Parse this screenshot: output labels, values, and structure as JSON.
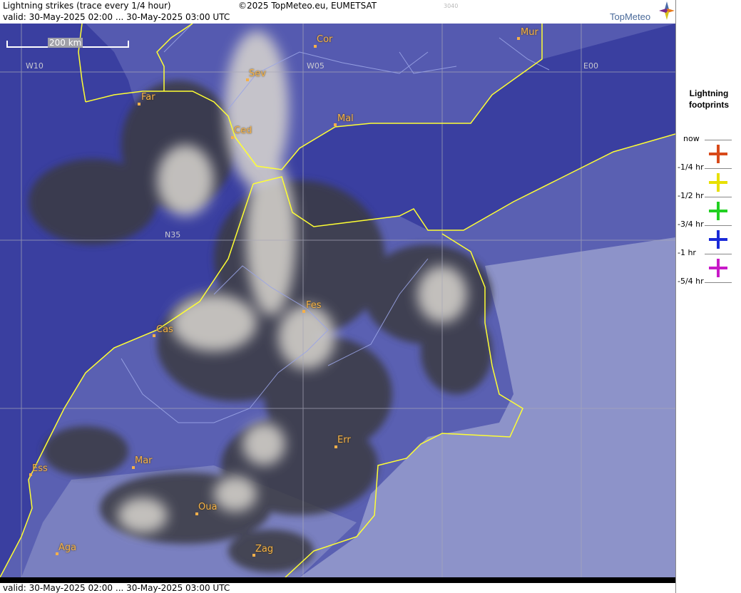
{
  "header": {
    "title": "Lightning strikes (trace every 1/4 hour)",
    "valid": "valid:  30-May-2025 02:00 ... 30-May-2025 03:00 UTC",
    "copyright": "©2025 TopMeteo.eu, EUMETSAT",
    "code": "3040",
    "logo_text": "TopMeteo"
  },
  "footer": {
    "valid": "valid:  30-May-2025 02:00 ... 30-May-2025 03:00 UTC"
  },
  "map": {
    "scale_label": "200 km",
    "grid_labels": {
      "w10": "W10",
      "w05": "W05",
      "e00": "E00",
      "n35": "N35"
    },
    "cities": {
      "cor": "Cor",
      "mur": "Mur",
      "sev": "Sev",
      "far": "Far",
      "ced": "Ced",
      "mal": "Mal",
      "fes": "Fes",
      "cas": "Cas",
      "err": "Err",
      "ess": "Ess",
      "mar": "Mar",
      "oua": "Oua",
      "aga": "Aga",
      "zag": "Zag"
    },
    "colors": {
      "sea": "#3a3fa0",
      "land": "#6a70b8",
      "desert": "#8d93c9",
      "cloud": "#d9d6cf",
      "border": "#ffff33",
      "river": "#9aa4e6",
      "city": "#f5b04a"
    }
  },
  "legend": {
    "title_line1": "Lightning",
    "title_line2": "footprints",
    "items": [
      {
        "label": "now",
        "color": "#d84a1a"
      },
      {
        "label": "-1/4 hr",
        "color": "#e8e000"
      },
      {
        "label": "-1/2 hr",
        "color": "#22d022"
      },
      {
        "label": "-3/4 hr",
        "color": "#1a2ad8"
      },
      {
        "label": "-1 hr",
        "color": "#c81ac8"
      },
      {
        "label": "-5/4 hr",
        "color": ""
      }
    ]
  }
}
